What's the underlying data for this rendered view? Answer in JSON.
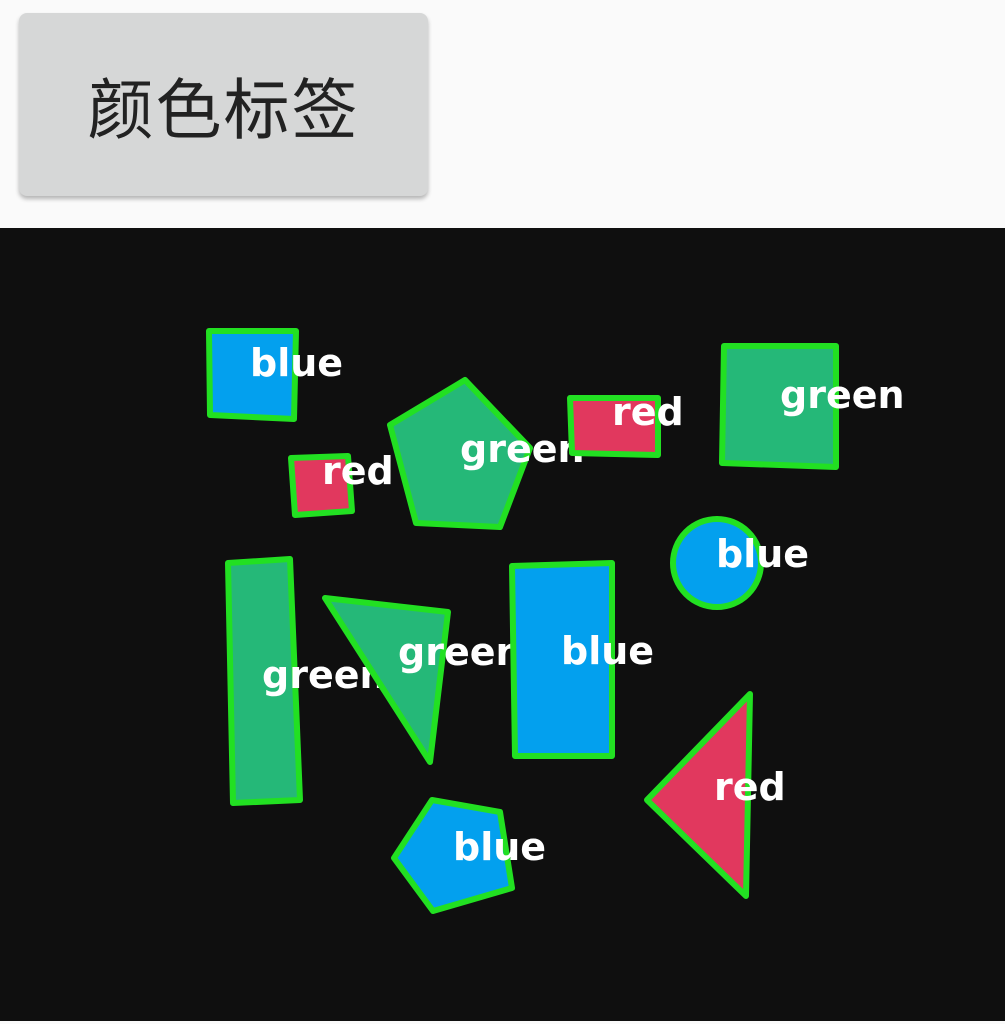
{
  "toolbar": {
    "button_label": "颜色标签"
  },
  "colors": {
    "background": "#fafafa",
    "button": "#d6d7d7",
    "image_bg": "#0f0f0f",
    "outline": "#22e022",
    "blue": "#03a0ee",
    "green": "#25b878",
    "red": "#e1385e",
    "label_text": "#ffffff"
  },
  "detections": [
    {
      "color": "blue",
      "shape": "square",
      "label": "blue"
    },
    {
      "color": "green",
      "shape": "pentagon",
      "label": "green"
    },
    {
      "color": "red",
      "shape": "rectangle",
      "label": "red"
    },
    {
      "color": "green",
      "shape": "square",
      "label": "green"
    },
    {
      "color": "red",
      "shape": "square",
      "label": "red"
    },
    {
      "color": "blue",
      "shape": "circle",
      "label": "blue"
    },
    {
      "color": "green",
      "shape": "rectangle",
      "label": "green"
    },
    {
      "color": "green",
      "shape": "triangle",
      "label": "green"
    },
    {
      "color": "blue",
      "shape": "rectangle",
      "label": "blue"
    },
    {
      "color": "red",
      "shape": "triangle",
      "label": "red"
    },
    {
      "color": "blue",
      "shape": "pentagon",
      "label": "blue"
    }
  ]
}
